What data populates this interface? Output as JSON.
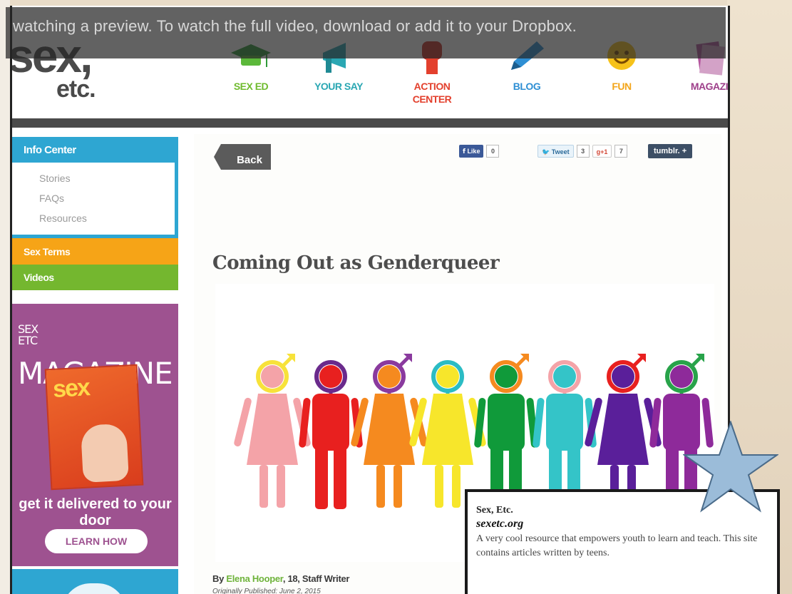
{
  "banner": {
    "text": "watching a preview. To watch the full video, download or add it to your Dropbox."
  },
  "logo": {
    "line1": "sex,",
    "line2": "etc."
  },
  "nav": [
    {
      "label": "SEX ED",
      "color": "#6fbb2e",
      "icon": "graduation-cap-icon"
    },
    {
      "label": "YOUR SAY",
      "color": "#2aa7b3",
      "icon": "megaphone-icon"
    },
    {
      "label": "ACTION CENTER",
      "color": "#e3402d",
      "icon": "raised-fist-icon"
    },
    {
      "label": "BLOG",
      "color": "#2e8fd4",
      "icon": "pencil-icon"
    },
    {
      "label": "FUN",
      "color": "#f3a51a",
      "icon": "smiley-icon"
    },
    {
      "label": "MAGAZI",
      "color": "#9e3f8a",
      "icon": "magazine-icon"
    }
  ],
  "sidebar": {
    "header": "Info Center",
    "links": [
      "Stories",
      "FAQs",
      "Resources"
    ],
    "terms": "Sex Terms",
    "videos": "Videos"
  },
  "promo": {
    "title_small": "SEX ETC",
    "title": "MAGAZINE",
    "cover_text": "sex",
    "tagline": "get it delivered to your door",
    "button": "LEARN HOW"
  },
  "article": {
    "back": "Back",
    "like_label": "Like",
    "like_count": "0",
    "tweet_label": "Tweet",
    "tweet_count": "3",
    "gplus_label": "+1",
    "gplus_count": "7",
    "tumblr": "tumblr. +",
    "title": "Coming Out as Genderqueer",
    "byline_prefix": "By ",
    "author": "Elena Hooper",
    "byline_suffix": ", 18, Staff Writer",
    "published": "Originally Published: June 2, 2015"
  },
  "figures": [
    {
      "body": "#f4a3a8",
      "head": "#f7e23a",
      "dress": true,
      "symbol": "male"
    },
    {
      "body": "#e8201f",
      "head": "#6a2a8c",
      "dress": false,
      "symbol": "female"
    },
    {
      "body": "#f58a1f",
      "head": "#8a3a9e",
      "dress": true,
      "symbol": "both"
    },
    {
      "body": "#f7e62b",
      "head": "#2bbcc4",
      "dress": true,
      "symbol": "female"
    },
    {
      "body": "#109a3a",
      "head": "#f58a1f",
      "dress": false,
      "symbol": "male"
    },
    {
      "body": "#34c4c8",
      "head": "#f4a3a8",
      "dress": false,
      "symbol": "female"
    },
    {
      "body": "#5a1f9a",
      "head": "#e8201f",
      "dress": true,
      "symbol": "male"
    },
    {
      "body": "#8e2a9a",
      "head": "#28a34a",
      "dress": false,
      "symbol": "both"
    }
  ],
  "note": {
    "name": "Sex, Etc.",
    "url": "sexetc.org",
    "description": "A very cool resource that empowers youth to learn and teach. This site contains articles written by teens."
  },
  "colors": {
    "sidebar_blue": "#2ea6d2",
    "terms_orange": "#f6a417",
    "videos_green": "#74b72f",
    "promo_purple": "#9e5290",
    "star": "#9bbcd9"
  }
}
